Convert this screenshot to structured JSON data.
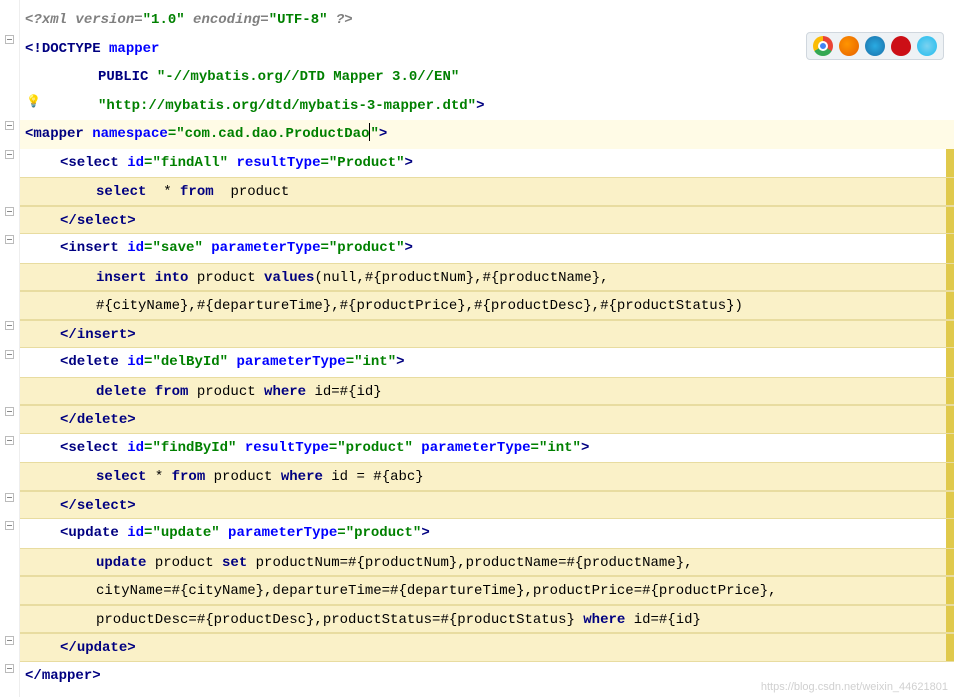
{
  "gutter": {
    "bulb": "💡"
  },
  "browser_icons": [
    "chrome",
    "firefox",
    "safari",
    "opera",
    "ie"
  ],
  "watermark": "https://blog.csdn.net/weixin_44621801",
  "code": {
    "l1": {
      "a": "<?",
      "b": "xml version",
      "c": "=",
      "d": "\"1.0\"",
      "e": " encoding",
      "f": "=",
      "g": "\"UTF-8\"",
      "h": " ?>"
    },
    "l2": {
      "a": "<!",
      "b": "DOCTYPE ",
      "c": "mapper"
    },
    "l3": {
      "a": "PUBLIC ",
      "b": "\"-//mybatis.org//DTD Mapper 3.0//EN\""
    },
    "l4": {
      "a": "\"http://mybatis.org/dtd/mybatis-3-mapper.dtd\"",
      "b": ">"
    },
    "l5": {
      "a": "<",
      "b": "mapper ",
      "c": "namespace",
      "d": "=",
      "e": "\"com.cad.dao.ProductDao",
      "f": "\"",
      "g": ">"
    },
    "l6": {
      "a": "<",
      "b": "select ",
      "c": "id",
      "d": "=",
      "e": "\"findAll\"",
      "f": " resultType",
      "g": "=",
      "h": "\"Product\"",
      "i": ">"
    },
    "l7": {
      "a": "select  ",
      "b": "*",
      "c": " from",
      "d": "  product"
    },
    "l8": {
      "a": "</",
      "b": "select",
      "c": ">"
    },
    "l9": {
      "a": "<",
      "b": "insert ",
      "c": "id",
      "d": "=",
      "e": "\"save\"",
      "f": " parameterType",
      "g": "=",
      "h": "\"product\"",
      "i": ">"
    },
    "l10": {
      "a": "insert into ",
      "b": "product ",
      "c": "values",
      "d": "(null,#{productNum},#{productName},"
    },
    "l11": {
      "a": "#{cityName},#{departureTime},#{productPrice},#{productDesc},#{productStatus})"
    },
    "l12": {
      "a": "</",
      "b": "insert",
      "c": ">"
    },
    "l13": {
      "a": "<",
      "b": "delete ",
      "c": "id",
      "d": "=",
      "e": "\"delById\"",
      "f": " parameterType",
      "g": "=",
      "h": "\"int\"",
      "i": ">"
    },
    "l14": {
      "a": "delete from ",
      "b": "product ",
      "c": "where ",
      "d": "id=#{id}"
    },
    "l15": {
      "a": "</",
      "b": "delete",
      "c": ">"
    },
    "l16": {
      "a": "<",
      "b": "select ",
      "c": "id",
      "d": "=",
      "e": "\"findById\"",
      "f": " resultType",
      "g": "=",
      "h": "\"product\"",
      "i": " parameterType",
      "j": "=",
      "k": "\"int\"",
      "l": ">"
    },
    "l17": {
      "a": "select ",
      "b": "*",
      "c": " from ",
      "d": "product ",
      "e": "where ",
      "f": "id = #{abc}"
    },
    "l18": {
      "a": "</",
      "b": "select",
      "c": ">"
    },
    "l19": {
      "a": "<",
      "b": "update ",
      "c": "id",
      "d": "=",
      "e": "\"update\"",
      "f": " parameterType",
      "g": "=",
      "h": "\"product\"",
      "i": ">"
    },
    "l20": {
      "a": "update ",
      "b": "product ",
      "c": "set ",
      "d": "productNum=#{productNum},productName=#{productName},"
    },
    "l21": {
      "a": "cityName=#{cityName},departureTime=#{departureTime},productPrice=#{productPrice},"
    },
    "l22": {
      "a": "productDesc=#{productDesc},productStatus=#{productStatus} ",
      "b": "where ",
      "c": "id=#{id}"
    },
    "l23": {
      "a": "</",
      "b": "update",
      "c": ">"
    },
    "l24": {
      "a": "</",
      "b": "mapper",
      "c": ">"
    }
  }
}
